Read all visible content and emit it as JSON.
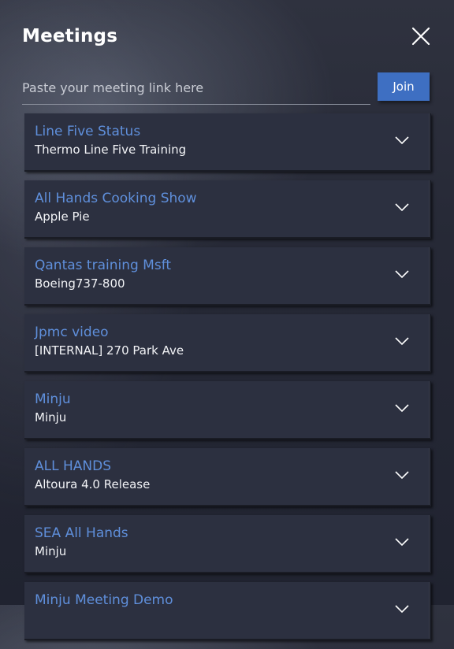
{
  "header": {
    "title": "Meetings",
    "close_icon": "close-icon"
  },
  "link_bar": {
    "placeholder": "Paste your meeting link here",
    "value": "",
    "join_label": "Join"
  },
  "colors": {
    "accent": "#3e6fc2",
    "meeting_title": "#5f8fdb"
  },
  "meetings": [
    {
      "title": "Line Five Status",
      "subtitle": "Thermo Line Five Training",
      "icon": "chevron-down-icon"
    },
    {
      "title": "All Hands Cooking Show",
      "subtitle": "Apple Pie",
      "icon": "chevron-down-icon"
    },
    {
      "title": "Qantas training Msft",
      "subtitle": "Boeing737-800",
      "icon": "chevron-down-icon"
    },
    {
      "title": "Jpmc video",
      "subtitle": "[INTERNAL] 270 Park Ave",
      "icon": "chevron-down-icon"
    },
    {
      "title": "Minju",
      "subtitle": "Minju",
      "icon": "chevron-down-icon"
    },
    {
      "title": "ALL HANDS",
      "subtitle": "Altoura 4.0 Release",
      "icon": "chevron-down-icon"
    },
    {
      "title": "SEA All Hands",
      "subtitle": "Minju",
      "icon": "chevron-down-icon"
    },
    {
      "title": "Minju Meeting Demo",
      "subtitle": "",
      "icon": "chevron-down-icon"
    }
  ]
}
